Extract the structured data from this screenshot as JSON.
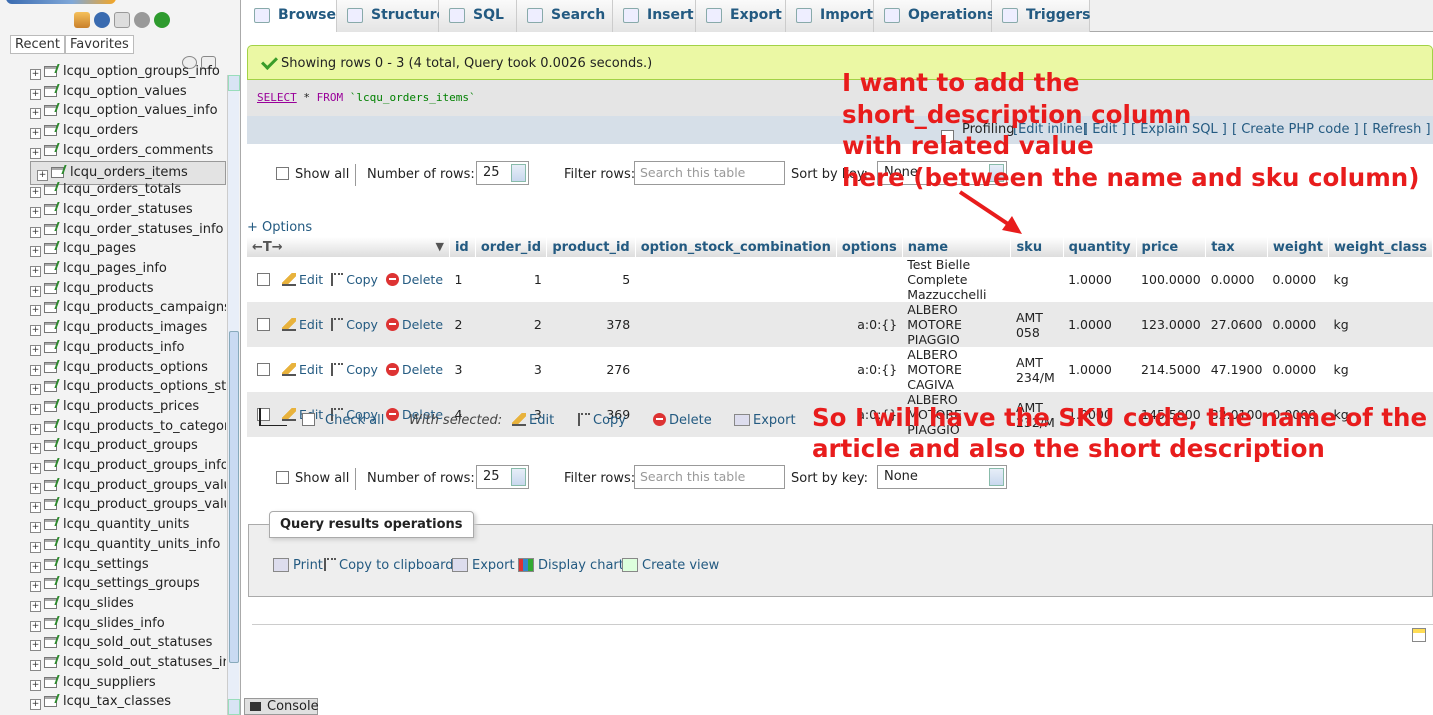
{
  "sidebar": {
    "tabs": [
      "Recent",
      "Favorites"
    ],
    "items": [
      {
        "label": "lcqu_option_groups_info",
        "selected": false
      },
      {
        "label": "lcqu_option_values",
        "selected": false
      },
      {
        "label": "lcqu_option_values_info",
        "selected": false
      },
      {
        "label": "lcqu_orders",
        "selected": false
      },
      {
        "label": "lcqu_orders_comments",
        "selected": false
      },
      {
        "label": "lcqu_orders_items",
        "selected": true
      },
      {
        "label": "lcqu_orders_totals",
        "selected": false
      },
      {
        "label": "lcqu_order_statuses",
        "selected": false
      },
      {
        "label": "lcqu_order_statuses_info",
        "selected": false
      },
      {
        "label": "lcqu_pages",
        "selected": false
      },
      {
        "label": "lcqu_pages_info",
        "selected": false
      },
      {
        "label": "lcqu_products",
        "selected": false
      },
      {
        "label": "lcqu_products_campaigns",
        "selected": false
      },
      {
        "label": "lcqu_products_images",
        "selected": false
      },
      {
        "label": "lcqu_products_info",
        "selected": false
      },
      {
        "label": "lcqu_products_options",
        "selected": false
      },
      {
        "label": "lcqu_products_options_sto",
        "selected": false
      },
      {
        "label": "lcqu_products_prices",
        "selected": false
      },
      {
        "label": "lcqu_products_to_categorie",
        "selected": false
      },
      {
        "label": "lcqu_product_groups",
        "selected": false
      },
      {
        "label": "lcqu_product_groups_info",
        "selected": false
      },
      {
        "label": "lcqu_product_groups_value",
        "selected": false
      },
      {
        "label": "lcqu_product_groups_value",
        "selected": false
      },
      {
        "label": "lcqu_quantity_units",
        "selected": false
      },
      {
        "label": "lcqu_quantity_units_info",
        "selected": false
      },
      {
        "label": "lcqu_settings",
        "selected": false
      },
      {
        "label": "lcqu_settings_groups",
        "selected": false
      },
      {
        "label": "lcqu_slides",
        "selected": false
      },
      {
        "label": "lcqu_slides_info",
        "selected": false
      },
      {
        "label": "lcqu_sold_out_statuses",
        "selected": false
      },
      {
        "label": "lcqu_sold_out_statuses_in",
        "selected": false
      },
      {
        "label": "lcqu_suppliers",
        "selected": false
      },
      {
        "label": "lcqu_tax_classes",
        "selected": false
      }
    ]
  },
  "tabs": [
    "Browse",
    "Structure",
    "SQL",
    "Search",
    "Insert",
    "Export",
    "Import",
    "Operations",
    "Triggers"
  ],
  "notice": "Showing rows 0 - 3 (4 total, Query took 0.0026 seconds.)",
  "sql": {
    "kw1": "SELECT",
    "rest": " * ",
    "kw2": "FROM",
    "table": " `lcqu_orders_items`"
  },
  "sql_tools": {
    "profiling": "Profiling",
    "edit_inline": "Edit inline",
    "edit": "Edit",
    "explain": "Explain SQL",
    "php": "Create PHP code",
    "refresh": "Refresh"
  },
  "nav": {
    "show_all": "Show all",
    "rows_label": "Number of rows:",
    "rows_value": "25",
    "filter_label": "Filter rows:",
    "filter_placeholder": "Search this table",
    "sort_label": "Sort by key:",
    "sort_value": "None"
  },
  "options_link": "+ Options",
  "table": {
    "columns": [
      "id",
      "order_id",
      "product_id",
      "option_stock_combination",
      "options",
      "name",
      "sku",
      "quantity",
      "price",
      "tax",
      "weight",
      "weight_class"
    ],
    "actions": {
      "edit": "Edit",
      "copy": "Copy",
      "delete": "Delete"
    },
    "rows": [
      {
        "id": "1",
        "order_id": "1",
        "product_id": "5",
        "osc": "",
        "options": "",
        "name": "Test Bielle Complete Mazzucchelli",
        "sku": "",
        "quantity": "1.0000",
        "price": "100.0000",
        "tax": "0.0000",
        "weight": "0.0000",
        "weight_class": "kg"
      },
      {
        "id": "2",
        "order_id": "2",
        "product_id": "378",
        "osc": "",
        "options": "a:0:{}",
        "name": "ALBERO MOTORE PIAGGIO",
        "sku": "AMT 058",
        "quantity": "1.0000",
        "price": "123.0000",
        "tax": "27.0600",
        "weight": "0.0000",
        "weight_class": "kg"
      },
      {
        "id": "3",
        "order_id": "3",
        "product_id": "276",
        "osc": "",
        "options": "a:0:{}",
        "name": "ALBERO MOTORE CAGIVA",
        "sku": "AMT 234/M",
        "quantity": "1.0000",
        "price": "214.5000",
        "tax": "47.1900",
        "weight": "0.0000",
        "weight_class": "kg"
      },
      {
        "id": "4",
        "order_id": "3",
        "product_id": "369",
        "osc": "",
        "options": "a:0:{}",
        "name": "ALBERO MOTORE PIAGGIO",
        "sku": "AMT 232/M",
        "quantity": "1.0000",
        "price": "145.5000",
        "tax": "32.0100",
        "weight": "0.0000",
        "weight_class": "kg"
      }
    ]
  },
  "bulk": {
    "check_all": "Check all",
    "with_selected": "With selected:",
    "edit": "Edit",
    "copy": "Copy",
    "delete": "Delete",
    "export": "Export"
  },
  "query_ops": {
    "legend": "Query results operations",
    "print": "Print",
    "copy": "Copy to clipboard",
    "export": "Export",
    "chart": "Display chart",
    "view": "Create view"
  },
  "console": "Console",
  "annotations": {
    "top": [
      "I want to add the",
      "short_description column",
      "with related value",
      "here (between the name and sku column)"
    ],
    "bottom": [
      "So I will have the SKU code, the name of the",
      "article and also the short description"
    ],
    "color": "#e81c1c"
  }
}
